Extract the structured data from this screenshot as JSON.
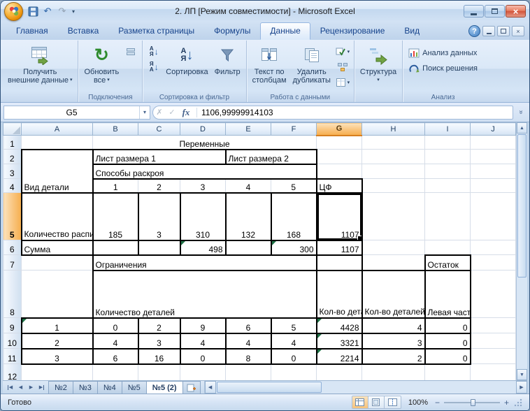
{
  "window": {
    "title": "2. ЛП  [Режим совместимости]  -  Microsoft Excel"
  },
  "icons": {
    "dropdown": "▾",
    "refresh": "↻",
    "undo": "↶",
    "redo": "↷",
    "arrow_down": "↓",
    "letter_a": "А",
    "letter_ya": "Я",
    "help": "?",
    "close": "×",
    "cancel": "✗",
    "enter": "✓",
    "chevrons": "»",
    "up": "▲",
    "down": "▼",
    "left": "◀",
    "right": "▶"
  },
  "ribbon": {
    "tabs": [
      "Главная",
      "Вставка",
      "Разметка страницы",
      "Формулы",
      "Данные",
      "Рецензирование",
      "Вид"
    ],
    "active_tab": "Данные",
    "get_external": {
      "line1": "Получить",
      "line2": "внешние данные"
    },
    "refresh_all": {
      "line1": "Обновить",
      "line2": "все"
    },
    "sort": "Сортировка",
    "filter": "Фильтр",
    "text_to_columns": {
      "line1": "Текст по",
      "line2": "столбцам"
    },
    "remove_duplicates": {
      "line1": "Удалить",
      "line2": "дубликаты"
    },
    "structure": "Структура",
    "data_analysis": "Анализ данных",
    "solver": "Поиск решения",
    "group_labels": {
      "connections": "Подключения",
      "sort_filter": "Сортировка и фильтр",
      "data_tools": "Работа с данными",
      "analysis": "Анализ"
    }
  },
  "formula_bar": {
    "name_box": "G5",
    "fx": "fx",
    "value": "1106,99999914103"
  },
  "grid": {
    "columns": [
      "A",
      "B",
      "C",
      "D",
      "E",
      "F",
      "G",
      "H",
      "I",
      "J"
    ],
    "rows": [
      "1",
      "2",
      "3",
      "4",
      "5",
      "6",
      "7",
      "8",
      "9",
      "10",
      "11",
      "12"
    ],
    "selected_cell": "G5",
    "selected_column": "G",
    "selected_row": "5"
  },
  "cells": {
    "b1": "Переменные",
    "a2": "Вид детали",
    "b2": "Лист размера 1",
    "e2": "Лист размера 2",
    "b3": "Способы раскроя",
    "b4": "1",
    "c4": "2",
    "d4": "3",
    "e4": "4",
    "f4": "5",
    "g4": "ЦФ",
    "a5": "Количество распиленных деталей",
    "b5": "185",
    "c5": "3",
    "d5": "310",
    "e5": "132",
    "f5": "168",
    "g5": "1107",
    "a6": "Сумма",
    "d6": "498",
    "f6": "300",
    "g6": "1107",
    "b7": "Ограничения",
    "i7": "Остаток",
    "b8": "Количество деталей",
    "g8": "Кол-во деталей",
    "h8": "Кол-во деталей в комплекте",
    "i8": "Левая часть",
    "a9": "1",
    "b9": "0",
    "c9": "2",
    "d9": "9",
    "e9": "6",
    "f9": "5",
    "g9": "4428",
    "h9": "4",
    "i9": "0",
    "a10": "2",
    "b10": "4",
    "c10": "3",
    "d10": "4",
    "e10": "4",
    "f10": "4",
    "g10": "3321",
    "h10": "3",
    "i10": "0",
    "a11": "3",
    "b11": "6",
    "c11": "16",
    "d11": "0",
    "e11": "8",
    "f11": "0",
    "g11": "2214",
    "h11": "2",
    "i11": "0"
  },
  "sheet_tabs": {
    "tabs": [
      "№2",
      "№3",
      "№4",
      "№5",
      "№5 (2)"
    ],
    "active": "№5 (2)"
  },
  "status_bar": {
    "mode": "Готово",
    "zoom": "100%"
  }
}
